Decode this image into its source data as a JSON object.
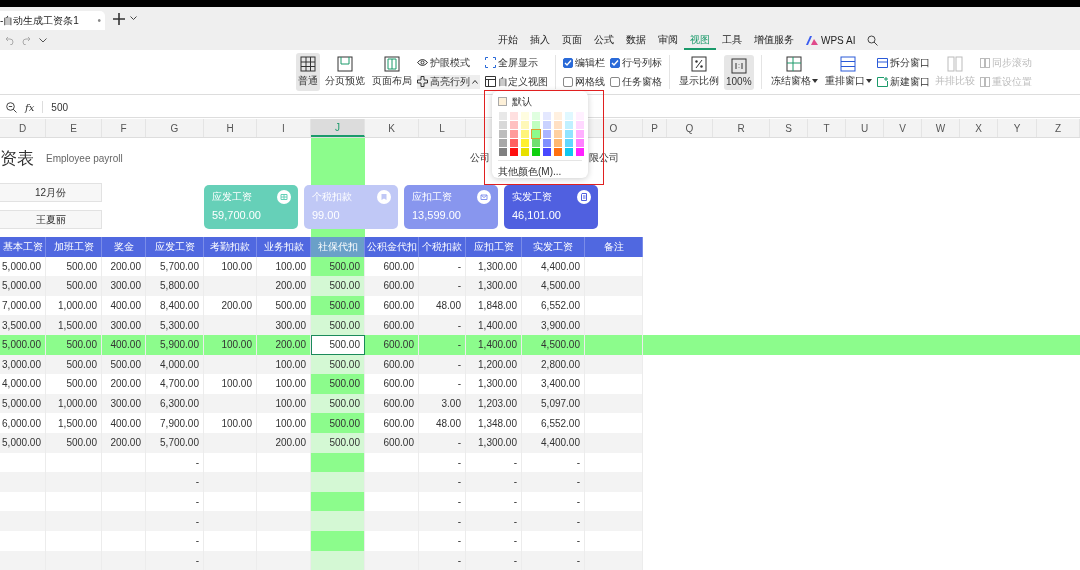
{
  "file_tab": {
    "title": "-自动生成工资条1",
    "modified_mark": "•"
  },
  "ribbon_tabs": [
    {
      "label": "开始",
      "selected": false
    },
    {
      "label": "插入",
      "selected": false
    },
    {
      "label": "页面",
      "selected": false
    },
    {
      "label": "公式",
      "selected": false
    },
    {
      "label": "数据",
      "selected": false
    },
    {
      "label": "审阅",
      "selected": false
    },
    {
      "label": "视图",
      "selected": true
    },
    {
      "label": "工具",
      "selected": false
    },
    {
      "label": "增值服务",
      "selected": false
    },
    {
      "label": "WPS AI",
      "selected": false,
      "kind": "ai"
    }
  ],
  "ribbon": {
    "view_buttons": [
      {
        "label": "普通",
        "selected": true
      },
      {
        "label": "分页预览",
        "selected": false
      },
      {
        "label": "页面布局",
        "selected": false
      }
    ],
    "small_buttons": [
      "护眼模式",
      "高亮行列",
      "全屏显示",
      "自定义视图"
    ],
    "checkboxes": [
      {
        "label": "编辑栏",
        "checked": true
      },
      {
        "label": "网格线",
        "checked": false
      },
      {
        "label": "行号列标",
        "checked": true
      },
      {
        "label": "任务窗格",
        "checked": false
      }
    ],
    "zoom_buttons": [
      {
        "label": "显示比例",
        "selected": false
      },
      {
        "label": "100%",
        "selected": true
      }
    ],
    "window_buttons": [
      "冻结窗格",
      "重排窗口"
    ],
    "window_small": [
      "拆分窗口",
      "新建窗口"
    ],
    "compare": {
      "label": "并排比较",
      "disabled": true
    },
    "sync_small": [
      {
        "label": "同步滚动",
        "disabled": true
      },
      {
        "label": "重设位置",
        "disabled": true
      }
    ]
  },
  "formula_bar": {
    "function_label": "fx",
    "value": "500"
  },
  "column_letters_left": [
    {
      "label": "D",
      "selected": false
    },
    {
      "label": "E",
      "selected": false
    },
    {
      "label": "F",
      "selected": false
    },
    {
      "label": "G",
      "selected": false
    },
    {
      "label": "H",
      "selected": false
    },
    {
      "label": "I",
      "selected": false
    },
    {
      "label": "J",
      "selected": true
    },
    {
      "label": "K",
      "selected": false
    },
    {
      "label": "L",
      "selected": false
    }
  ],
  "column_letters_right": [
    "O",
    "P",
    "Q",
    "R",
    "S",
    "T",
    "U",
    "V",
    "W",
    "X",
    "Y",
    "Z"
  ],
  "sheet": {
    "title": "资表",
    "subtitle": "Employee payroll",
    "company_left": "公司",
    "company_right": "限公司",
    "month": "12月份",
    "name": "王夏丽",
    "cards": [
      {
        "label": "应发工资",
        "value": "59,700.00",
        "color": "#66d0b8"
      },
      {
        "label": "个税扣款",
        "value": "99.00",
        "color": "#c0c8f6"
      },
      {
        "label": "应扣工资",
        "value": "13,599.00",
        "color": "#8896ee"
      },
      {
        "label": "实发工资",
        "value": "46,101.00",
        "color": "#5060e0"
      }
    ],
    "headers": [
      "基本工资",
      "加班工资",
      "奖金",
      "应发工资",
      "考勤扣款",
      "业务扣款",
      "社保代扣",
      "公积金代扣",
      "个税扣款",
      "应扣工资",
      "实发工资",
      "备注"
    ],
    "rows": [
      {
        "selected": false,
        "cells": [
          "5,000.00",
          "500.00",
          "200.00",
          "5,700.00",
          "100.00",
          "100.00",
          "500.00",
          "600.00",
          "-",
          "1,300.00",
          "4,400.00",
          null
        ]
      },
      {
        "selected": false,
        "cells": [
          "5,000.00",
          "500.00",
          "300.00",
          "5,800.00",
          null,
          "200.00",
          "500.00",
          "600.00",
          "-",
          "1,300.00",
          "4,500.00",
          null
        ]
      },
      {
        "selected": false,
        "cells": [
          "7,000.00",
          "1,000.00",
          "400.00",
          "8,400.00",
          "200.00",
          "500.00",
          "500.00",
          "600.00",
          "48.00",
          "1,848.00",
          "6,552.00",
          null
        ]
      },
      {
        "selected": false,
        "cells": [
          "3,500.00",
          "1,500.00",
          "300.00",
          "5,300.00",
          null,
          "300.00",
          "500.00",
          "600.00",
          "-",
          "1,400.00",
          "3,900.00",
          null
        ]
      },
      {
        "selected": true,
        "cells": [
          "5,000.00",
          "500.00",
          "400.00",
          "5,900.00",
          "100.00",
          "200.00",
          "500.00",
          "600.00",
          "-",
          "1,400.00",
          "4,500.00",
          null
        ]
      },
      {
        "selected": false,
        "cells": [
          "3,000.00",
          "500.00",
          "500.00",
          "4,000.00",
          null,
          "100.00",
          "500.00",
          "600.00",
          "-",
          "1,200.00",
          "2,800.00",
          null
        ]
      },
      {
        "selected": false,
        "cells": [
          "4,000.00",
          "500.00",
          "200.00",
          "4,700.00",
          "100.00",
          "100.00",
          "500.00",
          "600.00",
          "-",
          "1,300.00",
          "3,400.00",
          null
        ]
      },
      {
        "selected": false,
        "cells": [
          "5,000.00",
          "1,000.00",
          "300.00",
          "6,300.00",
          null,
          "100.00",
          "500.00",
          "600.00",
          "3.00",
          "1,203.00",
          "5,097.00",
          null
        ]
      },
      {
        "selected": false,
        "cells": [
          "6,000.00",
          "1,500.00",
          "400.00",
          "7,900.00",
          "100.00",
          "100.00",
          "500.00",
          "600.00",
          "48.00",
          "1,348.00",
          "6,552.00",
          null
        ]
      },
      {
        "selected": false,
        "cells": [
          "5,000.00",
          "500.00",
          "200.00",
          "5,700.00",
          null,
          "200.00",
          "500.00",
          "600.00",
          "-",
          "1,300.00",
          "4,400.00",
          null
        ]
      },
      {
        "selected": false,
        "cells": [
          null,
          null,
          null,
          "-",
          null,
          null,
          null,
          null,
          "-",
          "-",
          "-",
          null
        ]
      },
      {
        "selected": false,
        "cells": [
          null,
          null,
          null,
          "-",
          null,
          null,
          null,
          null,
          "-",
          "-",
          "-",
          null
        ]
      },
      {
        "selected": false,
        "cells": [
          null,
          null,
          null,
          "-",
          null,
          null,
          null,
          null,
          "-",
          "-",
          "-",
          null
        ]
      },
      {
        "selected": false,
        "cells": [
          null,
          null,
          null,
          "-",
          null,
          null,
          null,
          null,
          "-",
          "-",
          "-",
          null
        ]
      },
      {
        "selected": false,
        "cells": [
          null,
          null,
          null,
          "-",
          null,
          null,
          null,
          null,
          "-",
          "-",
          "-",
          null
        ]
      },
      {
        "selected": false,
        "cells": [
          null,
          null,
          null,
          "-",
          null,
          null,
          null,
          null,
          "-",
          "-",
          "-",
          null
        ]
      }
    ]
  },
  "highlight_menu": {
    "default_label": "默认",
    "more_label": "其他颜色(M)...",
    "palette": [
      {
        "color": "#e8e8e8",
        "selected": false
      },
      {
        "color": "#ffe0e0",
        "selected": false
      },
      {
        "color": "#fffde0",
        "selected": false
      },
      {
        "color": "#e0ffe0",
        "selected": false
      },
      {
        "color": "#e4e8ff",
        "selected": false
      },
      {
        "color": "#fff0e0",
        "selected": false
      },
      {
        "color": "#e0f8ff",
        "selected": false
      },
      {
        "color": "#fff0ff",
        "selected": false
      },
      {
        "color": "#d8d8d8",
        "selected": false
      },
      {
        "color": "#ffc0c0",
        "selected": false
      },
      {
        "color": "#fff8b8",
        "selected": false
      },
      {
        "color": "#c0ffc0",
        "selected": false
      },
      {
        "color": "#cad2ff",
        "selected": false
      },
      {
        "color": "#ffe0c4",
        "selected": false
      },
      {
        "color": "#c0f0ff",
        "selected": false
      },
      {
        "color": "#ffd8ff",
        "selected": false
      },
      {
        "color": "#bdbdbd",
        "selected": false
      },
      {
        "color": "#ff9a9a",
        "selected": false
      },
      {
        "color": "#fff47a",
        "selected": false
      },
      {
        "color": "#8cfc8c",
        "selected": true
      },
      {
        "color": "#aab4ff",
        "selected": false
      },
      {
        "color": "#ffd0a0",
        "selected": false
      },
      {
        "color": "#90e4ff",
        "selected": false
      },
      {
        "color": "#ffb0ff",
        "selected": false
      },
      {
        "color": "#a8a8a8",
        "selected": false
      },
      {
        "color": "#ff6060",
        "selected": false
      },
      {
        "color": "#fff030",
        "selected": false
      },
      {
        "color": "#70e070",
        "selected": false
      },
      {
        "color": "#8090ff",
        "selected": false
      },
      {
        "color": "#ffb870",
        "selected": false
      },
      {
        "color": "#60d8ff",
        "selected": false
      },
      {
        "color": "#ff80ff",
        "selected": false
      },
      {
        "color": "#808080",
        "selected": false
      },
      {
        "color": "#ff1010",
        "selected": false
      },
      {
        "color": "#e8e000",
        "selected": false
      },
      {
        "color": "#10d010",
        "selected": false
      },
      {
        "color": "#4848ff",
        "selected": false
      },
      {
        "color": "#ff7010",
        "selected": false
      },
      {
        "color": "#10c8f0",
        "selected": false
      },
      {
        "color": "#ff20ff",
        "selected": false
      }
    ]
  }
}
